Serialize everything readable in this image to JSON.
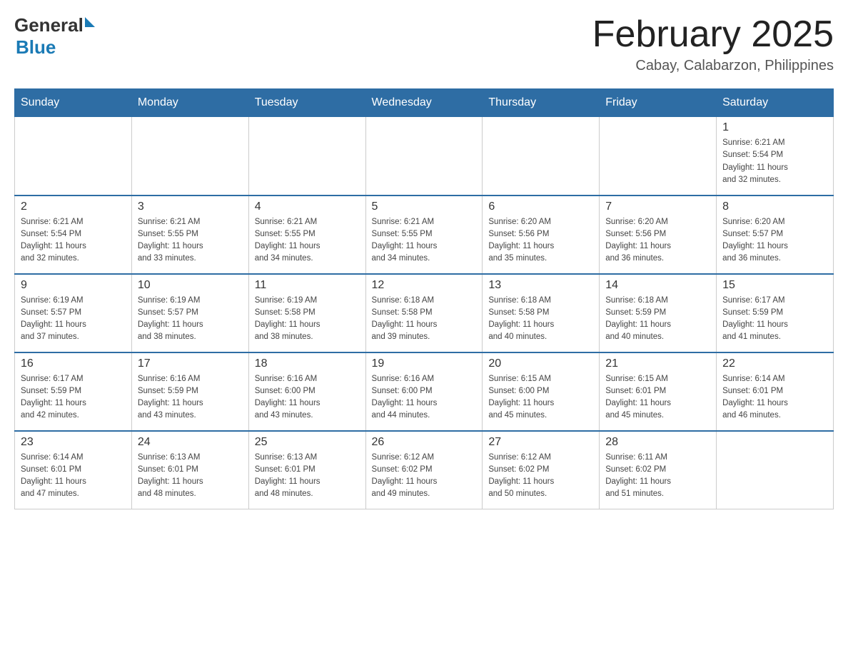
{
  "logo": {
    "general": "General",
    "blue": "Blue",
    "line2": "Blue"
  },
  "header": {
    "title": "February 2025",
    "location": "Cabay, Calabarzon, Philippines"
  },
  "days_of_week": [
    "Sunday",
    "Monday",
    "Tuesday",
    "Wednesday",
    "Thursday",
    "Friday",
    "Saturday"
  ],
  "weeks": [
    [
      {
        "day": "",
        "info": ""
      },
      {
        "day": "",
        "info": ""
      },
      {
        "day": "",
        "info": ""
      },
      {
        "day": "",
        "info": ""
      },
      {
        "day": "",
        "info": ""
      },
      {
        "day": "",
        "info": ""
      },
      {
        "day": "1",
        "info": "Sunrise: 6:21 AM\nSunset: 5:54 PM\nDaylight: 11 hours\nand 32 minutes."
      }
    ],
    [
      {
        "day": "2",
        "info": "Sunrise: 6:21 AM\nSunset: 5:54 PM\nDaylight: 11 hours\nand 32 minutes."
      },
      {
        "day": "3",
        "info": "Sunrise: 6:21 AM\nSunset: 5:55 PM\nDaylight: 11 hours\nand 33 minutes."
      },
      {
        "day": "4",
        "info": "Sunrise: 6:21 AM\nSunset: 5:55 PM\nDaylight: 11 hours\nand 34 minutes."
      },
      {
        "day": "5",
        "info": "Sunrise: 6:21 AM\nSunset: 5:55 PM\nDaylight: 11 hours\nand 34 minutes."
      },
      {
        "day": "6",
        "info": "Sunrise: 6:20 AM\nSunset: 5:56 PM\nDaylight: 11 hours\nand 35 minutes."
      },
      {
        "day": "7",
        "info": "Sunrise: 6:20 AM\nSunset: 5:56 PM\nDaylight: 11 hours\nand 36 minutes."
      },
      {
        "day": "8",
        "info": "Sunrise: 6:20 AM\nSunset: 5:57 PM\nDaylight: 11 hours\nand 36 minutes."
      }
    ],
    [
      {
        "day": "9",
        "info": "Sunrise: 6:19 AM\nSunset: 5:57 PM\nDaylight: 11 hours\nand 37 minutes."
      },
      {
        "day": "10",
        "info": "Sunrise: 6:19 AM\nSunset: 5:57 PM\nDaylight: 11 hours\nand 38 minutes."
      },
      {
        "day": "11",
        "info": "Sunrise: 6:19 AM\nSunset: 5:58 PM\nDaylight: 11 hours\nand 38 minutes."
      },
      {
        "day": "12",
        "info": "Sunrise: 6:18 AM\nSunset: 5:58 PM\nDaylight: 11 hours\nand 39 minutes."
      },
      {
        "day": "13",
        "info": "Sunrise: 6:18 AM\nSunset: 5:58 PM\nDaylight: 11 hours\nand 40 minutes."
      },
      {
        "day": "14",
        "info": "Sunrise: 6:18 AM\nSunset: 5:59 PM\nDaylight: 11 hours\nand 40 minutes."
      },
      {
        "day": "15",
        "info": "Sunrise: 6:17 AM\nSunset: 5:59 PM\nDaylight: 11 hours\nand 41 minutes."
      }
    ],
    [
      {
        "day": "16",
        "info": "Sunrise: 6:17 AM\nSunset: 5:59 PM\nDaylight: 11 hours\nand 42 minutes."
      },
      {
        "day": "17",
        "info": "Sunrise: 6:16 AM\nSunset: 5:59 PM\nDaylight: 11 hours\nand 43 minutes."
      },
      {
        "day": "18",
        "info": "Sunrise: 6:16 AM\nSunset: 6:00 PM\nDaylight: 11 hours\nand 43 minutes."
      },
      {
        "day": "19",
        "info": "Sunrise: 6:16 AM\nSunset: 6:00 PM\nDaylight: 11 hours\nand 44 minutes."
      },
      {
        "day": "20",
        "info": "Sunrise: 6:15 AM\nSunset: 6:00 PM\nDaylight: 11 hours\nand 45 minutes."
      },
      {
        "day": "21",
        "info": "Sunrise: 6:15 AM\nSunset: 6:01 PM\nDaylight: 11 hours\nand 45 minutes."
      },
      {
        "day": "22",
        "info": "Sunrise: 6:14 AM\nSunset: 6:01 PM\nDaylight: 11 hours\nand 46 minutes."
      }
    ],
    [
      {
        "day": "23",
        "info": "Sunrise: 6:14 AM\nSunset: 6:01 PM\nDaylight: 11 hours\nand 47 minutes."
      },
      {
        "day": "24",
        "info": "Sunrise: 6:13 AM\nSunset: 6:01 PM\nDaylight: 11 hours\nand 48 minutes."
      },
      {
        "day": "25",
        "info": "Sunrise: 6:13 AM\nSunset: 6:01 PM\nDaylight: 11 hours\nand 48 minutes."
      },
      {
        "day": "26",
        "info": "Sunrise: 6:12 AM\nSunset: 6:02 PM\nDaylight: 11 hours\nand 49 minutes."
      },
      {
        "day": "27",
        "info": "Sunrise: 6:12 AM\nSunset: 6:02 PM\nDaylight: 11 hours\nand 50 minutes."
      },
      {
        "day": "28",
        "info": "Sunrise: 6:11 AM\nSunset: 6:02 PM\nDaylight: 11 hours\nand 51 minutes."
      },
      {
        "day": "",
        "info": ""
      }
    ]
  ]
}
